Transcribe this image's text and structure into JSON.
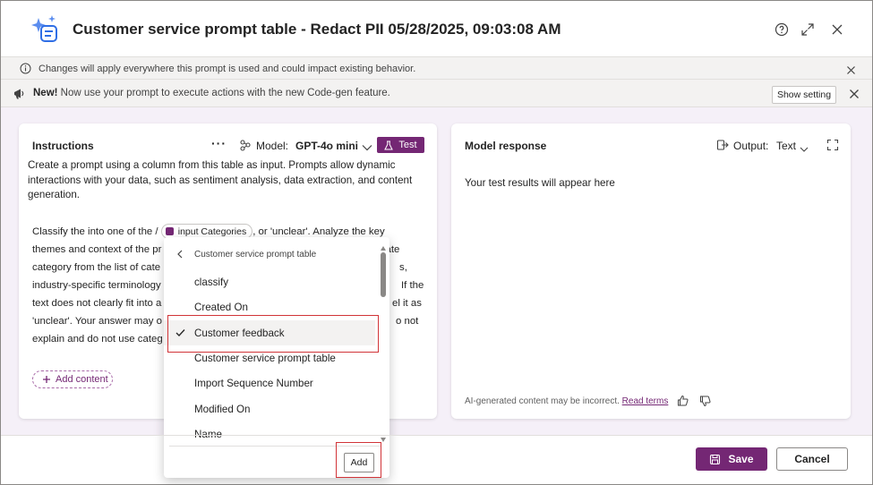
{
  "header": {
    "title": "Customer service prompt table - Redact PII 05/28/2025, 09:03:08 AM"
  },
  "info_bar": {
    "text": "Changes will apply everywhere this prompt is used and could impact existing behavior."
  },
  "announcement": {
    "new_label": "New!",
    "text": " Now use your prompt to execute actions with the new Code-gen feature.",
    "show_setting_label": "Show setting"
  },
  "instructions": {
    "title": "Instructions",
    "more": "···",
    "model_label": "Model:",
    "model_value": "GPT-4o mini",
    "test_label": "Test",
    "description": "Create a prompt using a column from this table as input. Prompts allow dynamic interactions with your data, such as sentiment analysis, data extraction, and content generation.",
    "body_line1_a": "Classify the  into one of the /",
    "chip_label": "input Categories",
    "body_line1_b": ", or 'unclear'. Analyze the key",
    "body_lines_left": [
      "themes and context of the pr",
      "category from the list of cate",
      "industry-specific terminology",
      "text does not clearly fit into a",
      "'unclear'. Your answer may o",
      "explain and do not use categ"
    ],
    "body_lines_right": [
      "iate",
      "s,",
      "If the",
      "el it as",
      "o not",
      ""
    ],
    "add_content_label": "Add content"
  },
  "dropdown": {
    "header": "Customer service prompt table",
    "items": [
      {
        "label": "classify",
        "selected": false
      },
      {
        "label": "Created On",
        "selected": false
      },
      {
        "label": "Customer feedback",
        "selected": true
      },
      {
        "label": "Customer service prompt table",
        "selected": false
      },
      {
        "label": "Import Sequence Number",
        "selected": false
      },
      {
        "label": "Modified On",
        "selected": false
      },
      {
        "label": "Name",
        "selected": false
      }
    ],
    "add_label": "Add"
  },
  "response": {
    "title": "Model response",
    "output_label": "Output:",
    "output_value": "Text",
    "placeholder": "Your test results will appear here",
    "disclaimer": "AI-generated content may be incorrect.",
    "read_terms": "Read terms"
  },
  "footer": {
    "save_label": "Save",
    "cancel_label": "Cancel"
  },
  "colors": {
    "accent": "#742774",
    "highlight": "#d13438"
  }
}
